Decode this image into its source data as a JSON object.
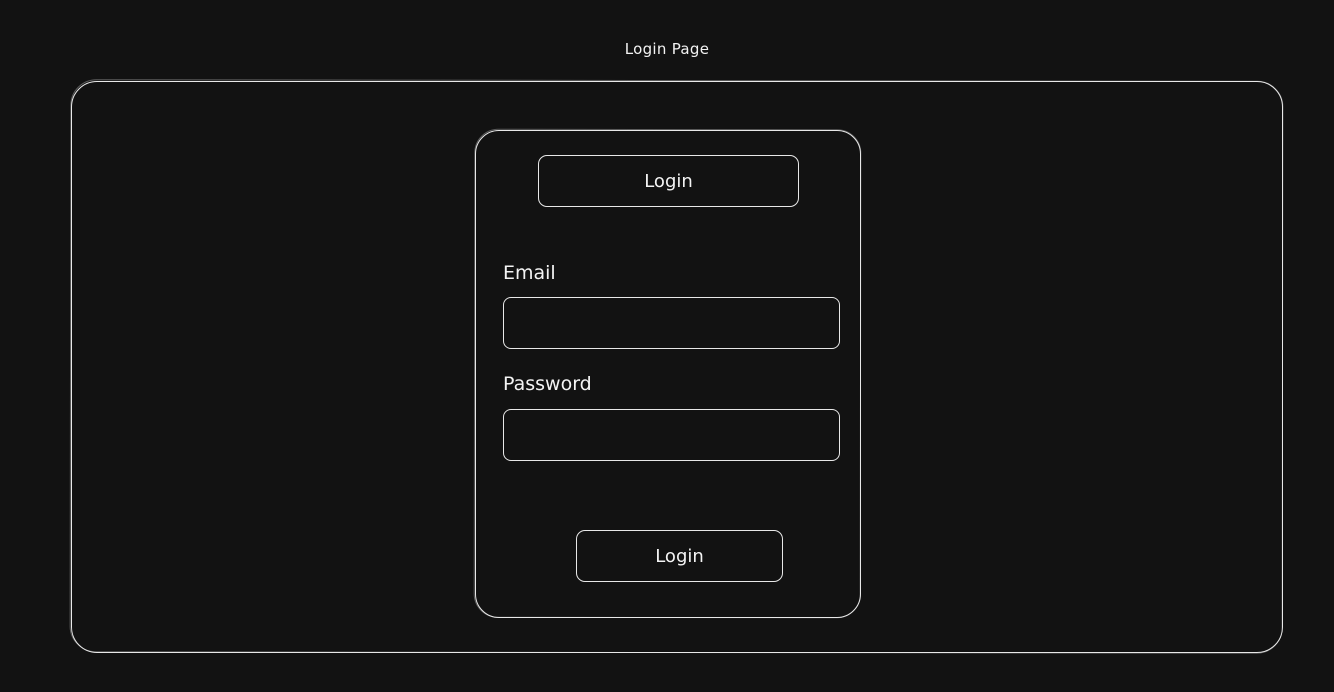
{
  "page": {
    "title": "Login Page"
  },
  "card": {
    "header_button_label": "Login",
    "email": {
      "label": "Email",
      "value": "",
      "placeholder": ""
    },
    "password": {
      "label": "Password",
      "value": "",
      "placeholder": ""
    },
    "submit_button_label": "Login"
  },
  "colors": {
    "background": "#121212",
    "stroke": "#e8e8e8",
    "text": "#f4f4f4"
  }
}
